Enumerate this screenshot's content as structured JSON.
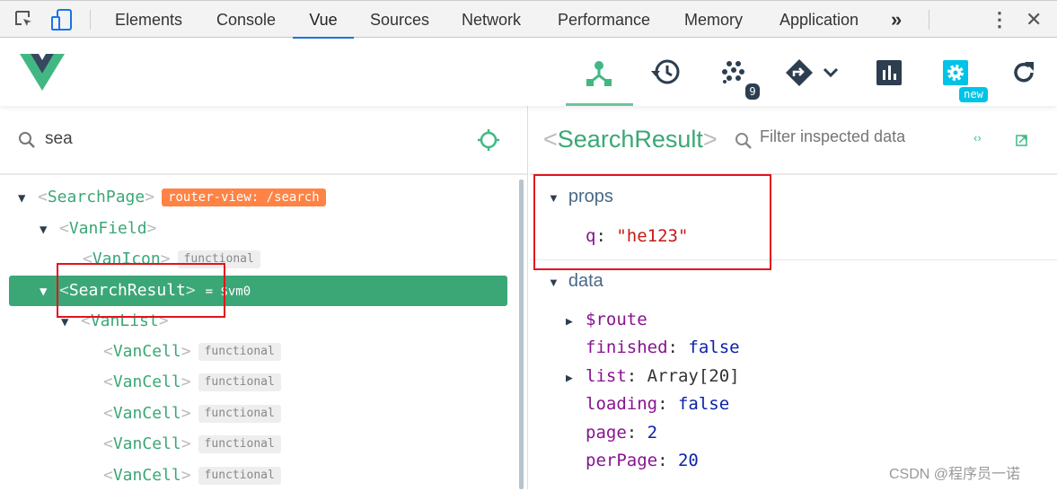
{
  "devtools": {
    "tabs": [
      "Elements",
      "Console",
      "Vue",
      "Sources",
      "Network",
      "Performance",
      "Memory",
      "Application"
    ],
    "active_tab": "Vue",
    "more": "»"
  },
  "toolbar": {
    "events_count": "9",
    "settings_badge": "new",
    "accent": "#41b883"
  },
  "tree": {
    "search_value": "sea",
    "rows": [
      {
        "name": "SearchPage",
        "badge": "router-view: /search",
        "expanded": true
      },
      {
        "name": "VanField",
        "expanded": true
      },
      {
        "name": "VanIcon",
        "badge": "functional"
      },
      {
        "name": "SearchResult",
        "suffix": "= $vm0",
        "expanded": true,
        "selected": true
      },
      {
        "name": "VanList",
        "expanded": true
      },
      {
        "name": "VanCell",
        "badge": "functional"
      },
      {
        "name": "VanCell",
        "badge": "functional"
      },
      {
        "name": "VanCell",
        "badge": "functional"
      },
      {
        "name": "VanCell",
        "badge": "functional"
      },
      {
        "name": "VanCell",
        "badge": "functional"
      }
    ]
  },
  "inspector": {
    "component": "SearchResult",
    "filter_placeholder": "Filter inspected data",
    "props_label": "props",
    "props": [
      {
        "key": "q",
        "value": "\"he123\""
      }
    ],
    "data_label": "data",
    "data": [
      {
        "key": "$route",
        "value": "",
        "expandable": true
      },
      {
        "key": "finished",
        "value": "false"
      },
      {
        "key": "list",
        "value": "Array[20]",
        "expandable": true
      },
      {
        "key": "loading",
        "value": "false"
      },
      {
        "key": "page",
        "value": "2"
      },
      {
        "key": "perPage",
        "value": "20"
      }
    ]
  },
  "watermark": "CSDN @程序员一诺"
}
